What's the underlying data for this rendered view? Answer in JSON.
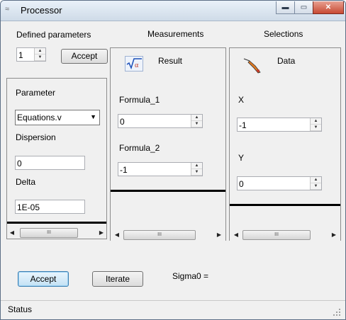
{
  "window": {
    "title": "Processor",
    "controls": {
      "minimize": "▬",
      "maximize": "▭",
      "close": "✕"
    }
  },
  "left": {
    "defined_parameters_label": "Defined parameters",
    "count_value": "1",
    "accept_label": "Accept",
    "parameter_label": "Parameter",
    "parameter_selected": "Equations.v",
    "dispersion_label": "Dispersion",
    "dispersion_value": "0",
    "delta_label": "Delta",
    "delta_value": "1E-05"
  },
  "measurements": {
    "header": "Measurements",
    "result_label": "Result",
    "icon": "sqrt-alpha-icon",
    "formulas": [
      {
        "label": "Formula_1",
        "value": "0"
      },
      {
        "label": "Formula_2",
        "value": "-1"
      }
    ]
  },
  "selections": {
    "header": "Selections",
    "data_label": "Data",
    "icon": "eyedropper-icon",
    "fields": [
      {
        "label": "X",
        "value": "-1"
      },
      {
        "label": "Y",
        "value": "0"
      }
    ]
  },
  "bottom": {
    "accept_label": "Accept",
    "iterate_label": "Iterate",
    "sigma_label": "Sigma0 ="
  },
  "status": {
    "text": "Status"
  },
  "scroll": {
    "thumb_glyph": "III",
    "left": "◀",
    "right": "▶"
  }
}
